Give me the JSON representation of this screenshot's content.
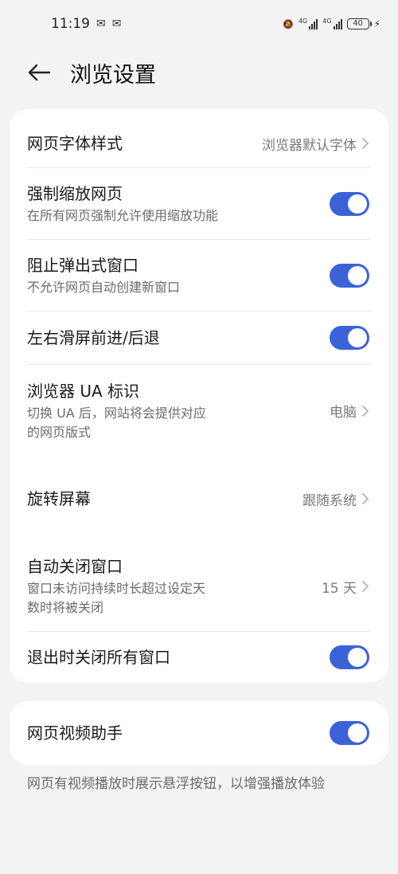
{
  "status": {
    "time": "11:19",
    "sig1_label": "4G",
    "sig2_label": "4G",
    "battery": "40"
  },
  "header": {
    "title": "浏览设置"
  },
  "settings": [
    {
      "title": "网页字体样式",
      "value": "浏览器默认字体"
    },
    {
      "title": "强制缩放网页",
      "subtitle": "在所有网页强制允许使用缩放功能",
      "on": true
    },
    {
      "title": "阻止弹出式窗口",
      "subtitle": "不允许网页自动创建新窗口",
      "on": true
    },
    {
      "title": "左右滑屏前进/后退",
      "on": true
    },
    {
      "title": "浏览器 UA 标识",
      "subtitle_line1": "切换 UA 后，网站将会提供对应",
      "subtitle_line2": "的网页版式",
      "value": "电脑"
    },
    {
      "title": "旋转屏幕",
      "value": "跟随系统"
    },
    {
      "title": "自动关闭窗口",
      "subtitle_line1": "窗口未访问持续时长超过设定天",
      "subtitle_line2": "数时将被关闭",
      "value": "15 天"
    },
    {
      "title": "退出时关闭所有窗口",
      "on": true
    }
  ],
  "video_helper": {
    "title": "网页视频助手",
    "on": true,
    "description": "网页有视频播放时展示悬浮按钮，以增强播放体验"
  },
  "colors": {
    "accent": "#3c62d8",
    "background": "#f1f3f5"
  }
}
